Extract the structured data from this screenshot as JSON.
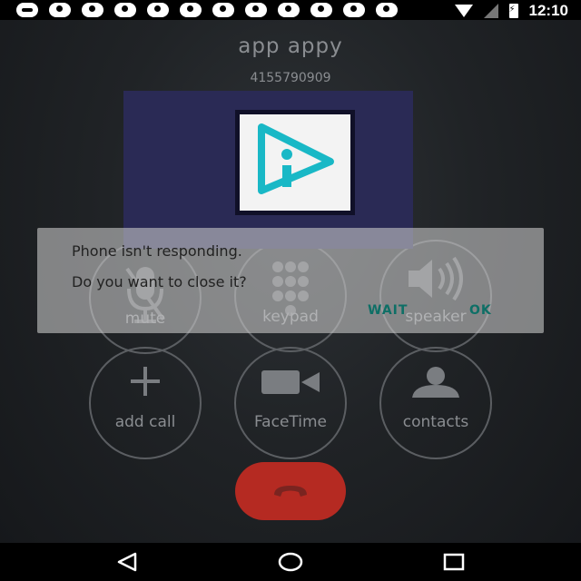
{
  "status_bar": {
    "time": "12:10",
    "notification_icons": [
      "message-icon",
      "music-note-icon",
      "music-note-icon",
      "music-note-icon",
      "music-note-icon",
      "music-note-icon",
      "music-note-icon",
      "music-note-icon",
      "music-note-icon",
      "music-note-icon",
      "music-note-icon",
      "music-note-icon"
    ]
  },
  "call": {
    "caller_name": "app appy",
    "caller_number": "4155790909"
  },
  "controls": [
    {
      "label": "mute",
      "icon": "mute-icon"
    },
    {
      "label": "keypad",
      "icon": "keypad-icon"
    },
    {
      "label": "speaker",
      "icon": "speaker-icon"
    },
    {
      "label": "add call",
      "icon": "plus-icon"
    },
    {
      "label": "FaceTime",
      "icon": "video-camera-icon"
    },
    {
      "label": "contacts",
      "icon": "contact-icon"
    }
  ],
  "dialog": {
    "title": "Phone isn't responding.",
    "message": "Do you want to close it?",
    "wait_label": "WAIT",
    "ok_label": "OK"
  },
  "end_call": {
    "icon": "end-call-icon",
    "color": "#b52a22"
  },
  "nav": {
    "back_icon": "back-icon",
    "home_icon": "home-icon",
    "recents_icon": "recents-icon"
  },
  "colors": {
    "accent": "#0e6f66",
    "logo_background": "#2a2a55",
    "logo_mark": "#19b8c6"
  }
}
